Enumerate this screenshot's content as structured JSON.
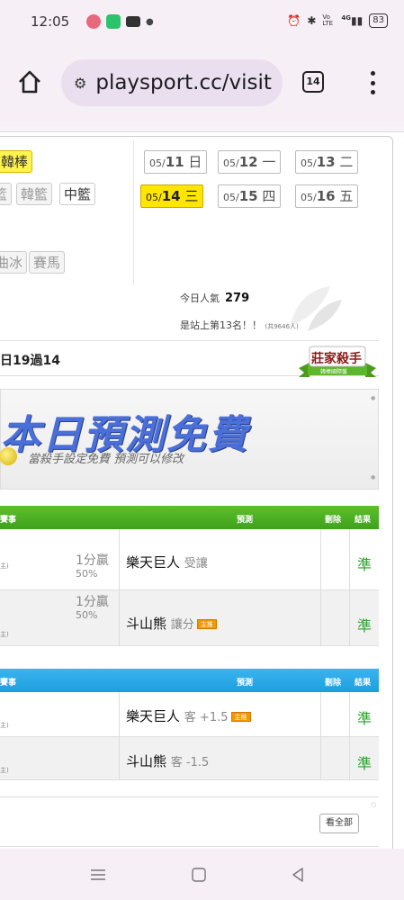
{
  "status_bar": {
    "time": "12:05",
    "signal": "4G",
    "network": "Vo LTE",
    "battery": "83"
  },
  "browser": {
    "url": "playsport.cc/visit",
    "tab_count": "14"
  },
  "sports": {
    "active": "韓棒",
    "row2": [
      "韓籃",
      "中籃"
    ],
    "row3": [
      "曲冰",
      "賽馬"
    ],
    "partial": "籃"
  },
  "dates": [
    {
      "md": "05/",
      "day": "11",
      "weekday": "日",
      "active": false
    },
    {
      "md": "05/",
      "day": "12",
      "weekday": "一",
      "active": false
    },
    {
      "md": "05/",
      "day": "13",
      "weekday": "二",
      "active": false
    },
    {
      "md": "05/",
      "day": "14",
      "weekday": "三",
      "active": true
    },
    {
      "md": "05/",
      "day": "15",
      "weekday": "四",
      "active": false
    },
    {
      "md": "05/",
      "day": "16",
      "weekday": "五",
      "active": false
    }
  ],
  "popularity": {
    "label": "今日人氣",
    "value": "279",
    "rank_text": "是站上第13名！！",
    "rank_total": "(共9646人)"
  },
  "record": {
    "text": "日19過14",
    "badge_main": "莊家殺手",
    "badge_sub": "韓棒國際盤"
  },
  "banner": {
    "title": "本日預測免費",
    "subtitle": "當殺手設定免費 預測可以修改"
  },
  "table1": {
    "headers": {
      "event": "賽事",
      "prediction": "預測",
      "delete": "刪除",
      "result": "結果"
    },
    "color": "#3fa01c",
    "rows": [
      {
        "note": "主)",
        "odds_line": "1分贏",
        "odds_pct": "50%",
        "team": "樂天巨人",
        "pick": "受讓",
        "host": false,
        "result": "準"
      },
      {
        "note": "主)",
        "odds_line": "1分贏",
        "odds_pct": "50%",
        "team": "斗山熊",
        "pick": "讓分",
        "host": true,
        "result": "準"
      }
    ]
  },
  "table2": {
    "headers": {
      "event": "賽事",
      "prediction": "預測",
      "delete": "刪除",
      "result": "結果"
    },
    "color": "#1e9ede",
    "rows": [
      {
        "note": "主)",
        "team": "樂天巨人",
        "pick": "客 +1.5",
        "host": true,
        "result": "準"
      },
      {
        "note": "主)",
        "team": "斗山熊",
        "pick": "客 -1.5",
        "host": false,
        "result": "準"
      }
    ]
  },
  "host_badge": "主推",
  "view_all": "看全部"
}
